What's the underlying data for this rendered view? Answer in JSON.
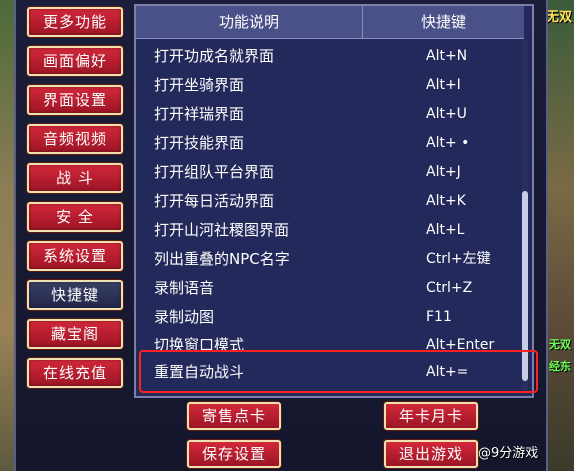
{
  "sidebar": {
    "items": [
      {
        "label": "更多功能"
      },
      {
        "label": "画面偏好"
      },
      {
        "label": "界面设置"
      },
      {
        "label": "音频视频"
      },
      {
        "label": "战 斗"
      },
      {
        "label": "安 全"
      },
      {
        "label": "系统设置"
      },
      {
        "label": "快捷键",
        "active": true
      },
      {
        "label": "藏宝阁"
      },
      {
        "label": "在线充值"
      }
    ]
  },
  "table": {
    "headers": {
      "function": "功能说明",
      "shortcut": "快捷键"
    },
    "rows": [
      {
        "name": "打开功成名就界面",
        "key": "Alt+N"
      },
      {
        "name": "打开坐骑界面",
        "key": "Alt+I"
      },
      {
        "name": "打开祥瑞界面",
        "key": "Alt+U"
      },
      {
        "name": "打开技能界面",
        "key": "Alt+ •"
      },
      {
        "name": "打开组队平台界面",
        "key": "Alt+J"
      },
      {
        "name": "打开每日活动界面",
        "key": "Alt+K"
      },
      {
        "name": "打开山河社稷图界面",
        "key": "Alt+L"
      },
      {
        "name": "列出重叠的NPC名字",
        "key": "Ctrl+左键"
      },
      {
        "name": "录制语音",
        "key": "Ctrl+Z"
      },
      {
        "name": "录制动图",
        "key": "F11"
      },
      {
        "name": "切换窗口模式",
        "key": "Alt+Enter"
      },
      {
        "name": "重置自动战斗",
        "key": "Alt+="
      }
    ]
  },
  "bottom_buttons": {
    "sell_card": "寄售点卡",
    "year_month_card": "年卡月卡",
    "save_settings": "保存设置",
    "exit_game": "退出游戏"
  },
  "edge_text": {
    "top_right": "无双",
    "mid_right_1": "无双",
    "mid_right_2": "经东"
  },
  "watermark": "@9分游戏",
  "colors": {
    "button_red": "#c01f30",
    "panel_bg": "#23295a",
    "header_bg": "#4a5088",
    "highlight": "#ff2020"
  }
}
